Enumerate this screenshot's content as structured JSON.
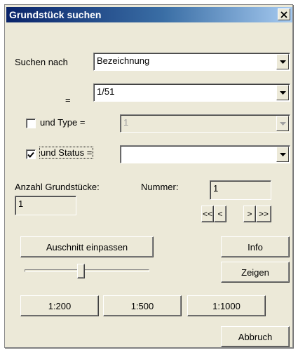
{
  "window": {
    "title": "Grundstück suchen",
    "close_glyph": "✕"
  },
  "search": {
    "label": "Suchen nach",
    "value": "Bezeichnung"
  },
  "equals": {
    "label": "=",
    "value": "1/51"
  },
  "type_filter": {
    "label": "und Type =",
    "checked": false,
    "value": "1"
  },
  "status_filter": {
    "label": "und Status =",
    "checked": true,
    "value": ""
  },
  "count": {
    "label": "Anzahl Grundstücke:",
    "value": "1"
  },
  "number": {
    "label": "Nummer:",
    "value": "1"
  },
  "nav": {
    "first": "<<",
    "prev": "<",
    "next": ">",
    "last": ">>"
  },
  "buttons": {
    "fit": "Auschnitt einpassen",
    "info": "Info",
    "show": "Zeigen",
    "scale_200": "1:200",
    "scale_500": "1:500",
    "scale_1000": "1:1000",
    "cancel": "Abbruch"
  },
  "slider": {
    "value": 0.45
  },
  "colors": {
    "face": "#ece9d8",
    "title_start": "#0a246a",
    "title_end": "#a6caf0"
  }
}
